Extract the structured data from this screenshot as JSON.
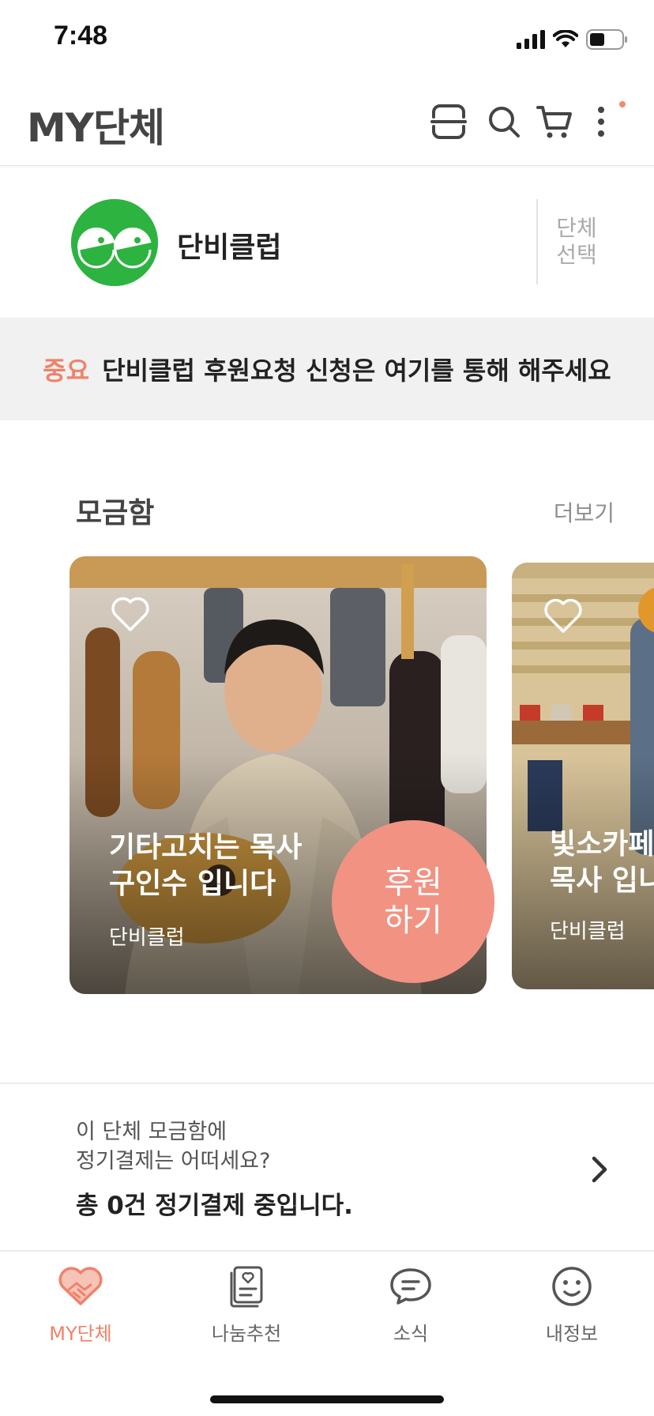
{
  "status_bar": {
    "time": "7:48"
  },
  "header": {
    "title": "MY단체",
    "icons": [
      "scan-icon",
      "search-icon",
      "cart-icon",
      "more-vertical-icon"
    ]
  },
  "organization": {
    "name": "단비클럽",
    "select_label": "단체\n선택",
    "logo_color": "#2db340"
  },
  "notice": {
    "badge": "중요",
    "text": "단비클럽 후원요청 신청은 여기를 통해 해주세요"
  },
  "fundraising": {
    "section_title": "모금함",
    "more_label": "더보기",
    "cards": [
      {
        "title": "기타고치는 목사\n구인수 입니다",
        "org": "단비클럽",
        "donate_label": "후원\n하기"
      },
      {
        "title": "빛소카페\n목사 입니",
        "org": "단비클럽"
      }
    ]
  },
  "regular_payment": {
    "question": "이 단체 모금함에\n정기결제는 어떠세요?",
    "status": "총 0건 정기결제 중입니다."
  },
  "tabs": [
    {
      "label": "MY단체",
      "icon": "handshake-heart-icon",
      "active": true
    },
    {
      "label": "나눔추천",
      "icon": "document-recommend-icon",
      "active": false
    },
    {
      "label": "소식",
      "icon": "chat-bubble-icon",
      "active": false
    },
    {
      "label": "내정보",
      "icon": "smiley-face-icon",
      "active": false
    }
  ],
  "colors": {
    "accent": "#f0826a",
    "donate_button": "#f29283",
    "brand_green": "#2db340"
  }
}
